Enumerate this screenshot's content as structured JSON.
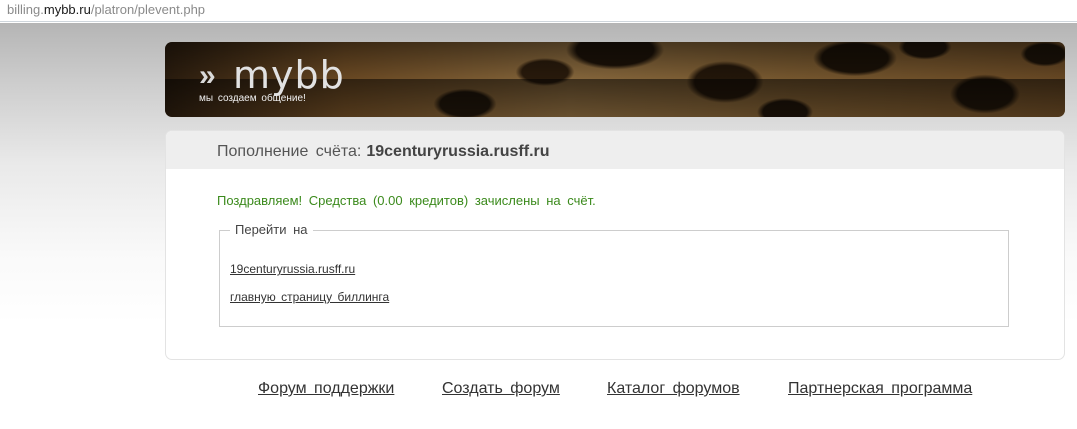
{
  "url_bar": {
    "prefix": "billing.",
    "host": "mybb.ru",
    "path": "/platron/plevent.php"
  },
  "banner": {
    "logo_arrows": "»",
    "logo_word": "mybb",
    "logo_tagline": "мы создаем общение!"
  },
  "panel": {
    "title_label": "Пополнение счёта:",
    "title_domain": "19centuryrussia.rusff.ru",
    "success_message": "Поздравляем! Средства (0.00 кредитов) зачислены на счёт.",
    "goto_legend": "Перейти на",
    "links": [
      "19centuryrussia.rusff.ru",
      "главную страницу биллинга"
    ]
  },
  "footer": {
    "links": [
      "Форум поддержки",
      "Создать форум",
      "Каталог форумов",
      "Партнерская программа"
    ]
  },
  "colors": {
    "success_text": "#3b8a1c",
    "panel_header_bg": "#eeeeee"
  }
}
